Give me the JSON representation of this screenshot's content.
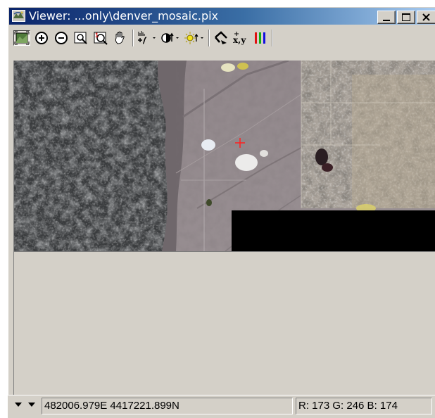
{
  "window": {
    "title": "Viewer: ...only\\denver_mosaic.pix",
    "icon": "viewer-app-icon",
    "controls": [
      "minimize-icon",
      "maximize-icon",
      "close-icon"
    ]
  },
  "toolbar": {
    "tools": [
      {
        "name": "zoom-to-overview-icon"
      },
      {
        "name": "zoom-in-icon"
      },
      {
        "name": "zoom-out-icon"
      },
      {
        "name": "zoom-to-fit-icon"
      },
      {
        "name": "zoom-to-1-1-icon"
      },
      {
        "name": "pan-hand-icon"
      },
      {
        "name": "enhancement-dropdown-icon"
      },
      {
        "name": "contrast-dropdown-icon"
      },
      {
        "name": "brightness-dropdown-icon"
      },
      {
        "name": "roam-cursor-icon"
      },
      {
        "name": "coordinate-display-icon"
      },
      {
        "name": "rgb-channels-icon"
      }
    ],
    "coord_glyph": "x,y"
  },
  "image": {
    "name": "denver_mosaic",
    "cursor": "red-crosshair"
  },
  "status": {
    "coordinates": "482006.979E 4417221.899N",
    "pixel_values": "R: 173 G: 246 B: 174"
  },
  "colors": {
    "titlebar_start": "#0a246a",
    "titlebar_end": "#a6caf0",
    "chrome": "#d4d0c8",
    "cursor": "#ff2020"
  }
}
